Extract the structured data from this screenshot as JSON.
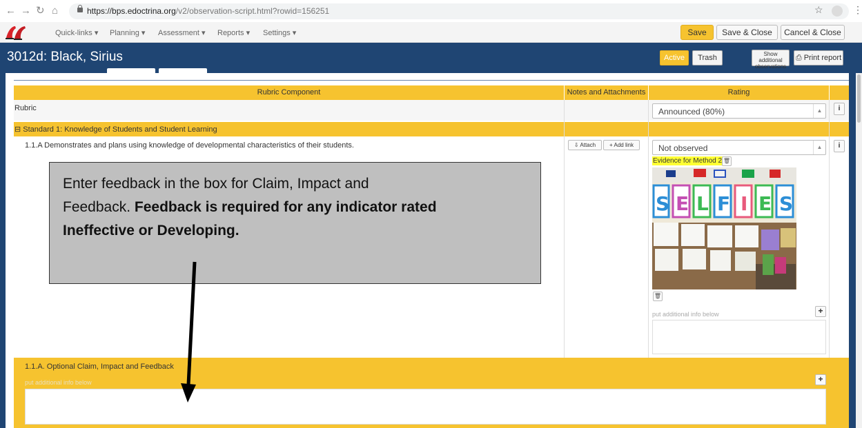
{
  "browser": {
    "url_host": "https://bps.edoctrina.org",
    "url_path": "/v2/observation-script.html?rowid=156251"
  },
  "appnav": {
    "menus": [
      "Quick-links ▾",
      "Planning ▾",
      "Assessment ▾",
      "Reports ▾",
      "Settings ▾"
    ],
    "save": "Save",
    "save_close": "Save & Close",
    "cancel_close": "Cancel & Close"
  },
  "titlebar": {
    "title": "3012d: Black, Sirius",
    "active": "Active",
    "trash": "Trash",
    "show_additional": "Show additional observations",
    "print_report": "Print report"
  },
  "table": {
    "headers": {
      "rubric_component": "Rubric Component",
      "notes": "Notes and Attachments",
      "rating": "Rating"
    },
    "rubric_label": "Rubric",
    "rubric_select": "Announced (80%)",
    "standard": "⊟ Standard 1: Knowledge of Students and Student Learning",
    "indicator": "1.1.A Demonstrates and plans using knowledge of developmental characteristics of their students.",
    "attach": "Attach",
    "add_link": "+ Add link",
    "rating_select": "Not observed",
    "evidence_tag": "Evidence for Method 2.",
    "additional_hint": "put additional info below",
    "optional_title": "1.1.A. Optional Claim, Impact and Feedback",
    "optional_hint": "put additional info below"
  },
  "photo": {
    "letters": [
      "S",
      "E",
      "L",
      "F",
      "I",
      "E",
      "S"
    ]
  },
  "callout": {
    "line1": "Enter feedback in the box for Claim, Impact and",
    "line2_plain": "Feedback.",
    "line2_bold": "Feedback is required for any indicator rated",
    "line3_bold": "Ineffective or Developing."
  },
  "colors": {
    "navy": "#1f4573",
    "gold": "#f6c32f",
    "evidence_highlight": "#ffff33"
  },
  "icons": [
    "back-arrow",
    "forward-arrow",
    "reload",
    "home",
    "lock",
    "star",
    "profile",
    "kebab-menu",
    "logo-shoes",
    "print-icon",
    "attach-icon",
    "plus-icon",
    "info-icon",
    "trash-icon"
  ]
}
